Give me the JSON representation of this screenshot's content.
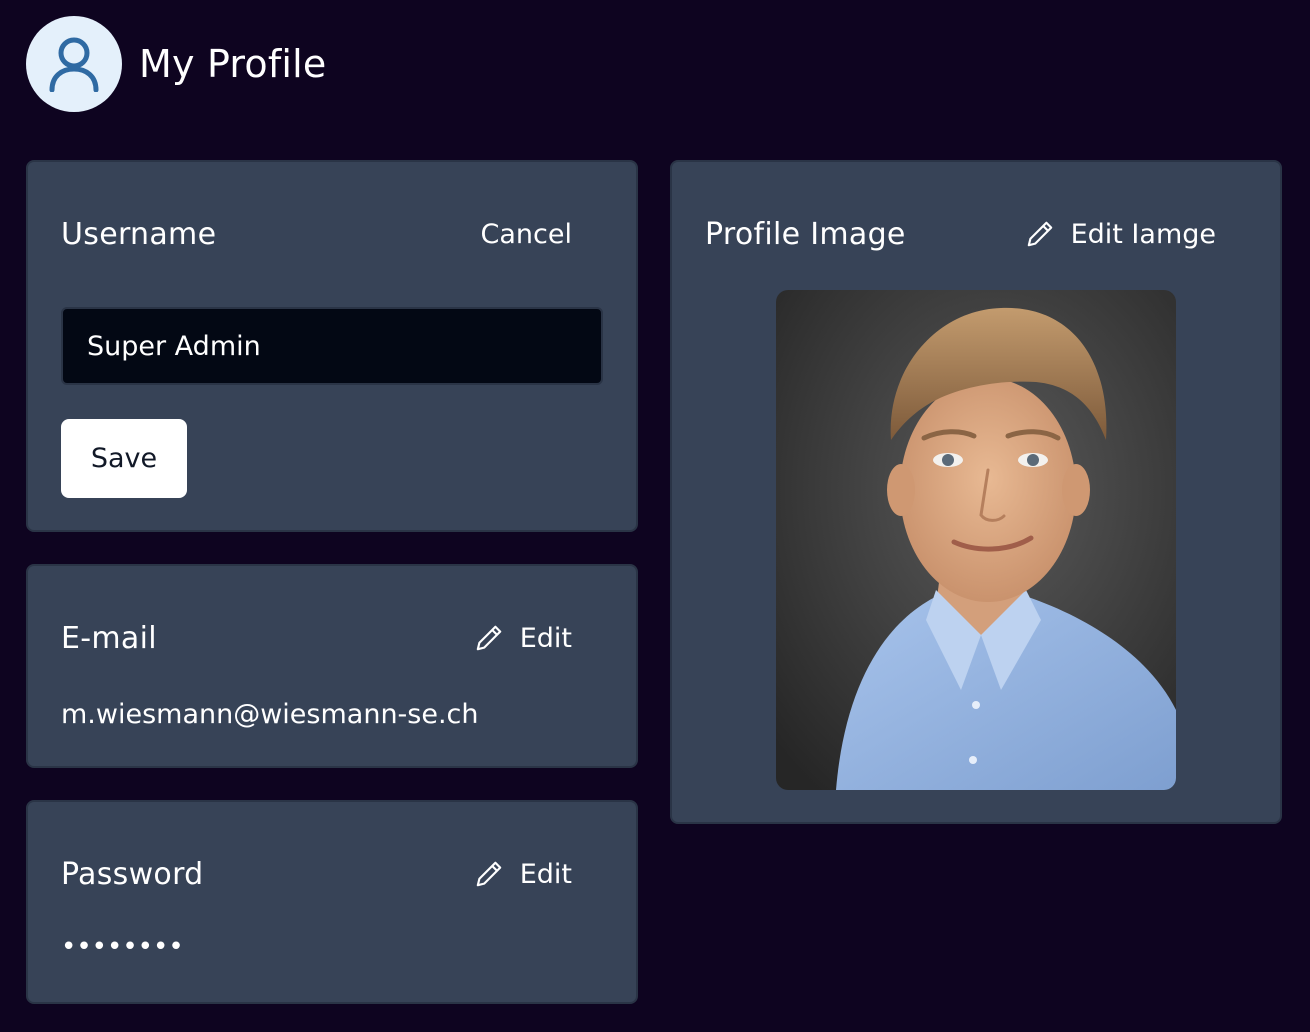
{
  "header": {
    "title": "My Profile",
    "avatar_icon": "user-icon"
  },
  "username_card": {
    "title": "Username",
    "cancel_label": "Cancel",
    "input_value": "Super Admin",
    "save_label": "Save"
  },
  "email_card": {
    "title": "E-mail",
    "edit_label": "Edit",
    "edit_icon": "pencil-icon",
    "value": "m.wiesmann@wiesmann-se.ch"
  },
  "password_card": {
    "title": "Password",
    "edit_label": "Edit",
    "edit_icon": "pencil-icon",
    "value": "••••••••"
  },
  "image_card": {
    "title": "Profile Image",
    "edit_label": "Edit Iamge",
    "edit_icon": "pencil-icon",
    "photo_alt": "profile-photo"
  },
  "colors": {
    "background": "#0e0420",
    "card": "#374357",
    "input_bg": "#030814",
    "avatar_bg": "#e4f0fb",
    "avatar_icon": "#2f6aa3",
    "button_bg": "#ffffff"
  }
}
